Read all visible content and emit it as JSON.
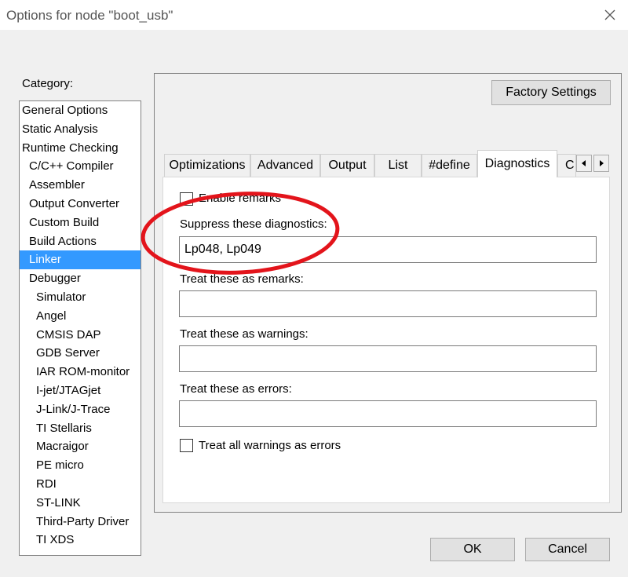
{
  "window": {
    "title": "Options for node \"boot_usb\""
  },
  "category": {
    "label": "Category:",
    "items": [
      {
        "label": "General Options",
        "level": 0
      },
      {
        "label": "Static Analysis",
        "level": 0
      },
      {
        "label": "Runtime Checking",
        "level": 0
      },
      {
        "label": "C/C++ Compiler",
        "level": 1
      },
      {
        "label": "Assembler",
        "level": 1
      },
      {
        "label": "Output Converter",
        "level": 1
      },
      {
        "label": "Custom Build",
        "level": 1
      },
      {
        "label": "Build Actions",
        "level": 1
      },
      {
        "label": "Linker",
        "level": 1,
        "selected": true
      },
      {
        "label": "Debugger",
        "level": 1
      },
      {
        "label": "Simulator",
        "level": 2
      },
      {
        "label": "Angel",
        "level": 2
      },
      {
        "label": "CMSIS DAP",
        "level": 2
      },
      {
        "label": "GDB Server",
        "level": 2
      },
      {
        "label": "IAR ROM-monitor",
        "level": 2
      },
      {
        "label": "I-jet/JTAGjet",
        "level": 2
      },
      {
        "label": "J-Link/J-Trace",
        "level": 2
      },
      {
        "label": "TI Stellaris",
        "level": 2
      },
      {
        "label": "Macraigor",
        "level": 2
      },
      {
        "label": "PE micro",
        "level": 2
      },
      {
        "label": "RDI",
        "level": 2
      },
      {
        "label": "ST-LINK",
        "level": 2
      },
      {
        "label": "Third-Party Driver",
        "level": 2
      },
      {
        "label": "TI XDS",
        "level": 2
      }
    ]
  },
  "factory_settings_label": "Factory Settings",
  "tabs": [
    {
      "label": "Optimizations"
    },
    {
      "label": "Advanced"
    },
    {
      "label": "Output"
    },
    {
      "label": "List"
    },
    {
      "label": "#define"
    },
    {
      "label": "Diagnostics",
      "active": true
    },
    {
      "label": "C"
    }
  ],
  "diagnostics": {
    "enable_remarks": {
      "label": "Enable remarks",
      "checked": false
    },
    "suppress": {
      "label": "Suppress these diagnostics:",
      "value": "Lp048, Lp049"
    },
    "remarks": {
      "label": "Treat these as remarks:",
      "value": ""
    },
    "warnings": {
      "label": "Treat these as warnings:",
      "value": ""
    },
    "errors": {
      "label": "Treat these as errors:",
      "value": ""
    },
    "all_warnings_errors": {
      "label": "Treat all warnings as errors",
      "checked": false
    }
  },
  "buttons": {
    "ok": "OK",
    "cancel": "Cancel"
  },
  "colors": {
    "selection": "#3399ff",
    "highlight_ring": "#e3141b"
  }
}
